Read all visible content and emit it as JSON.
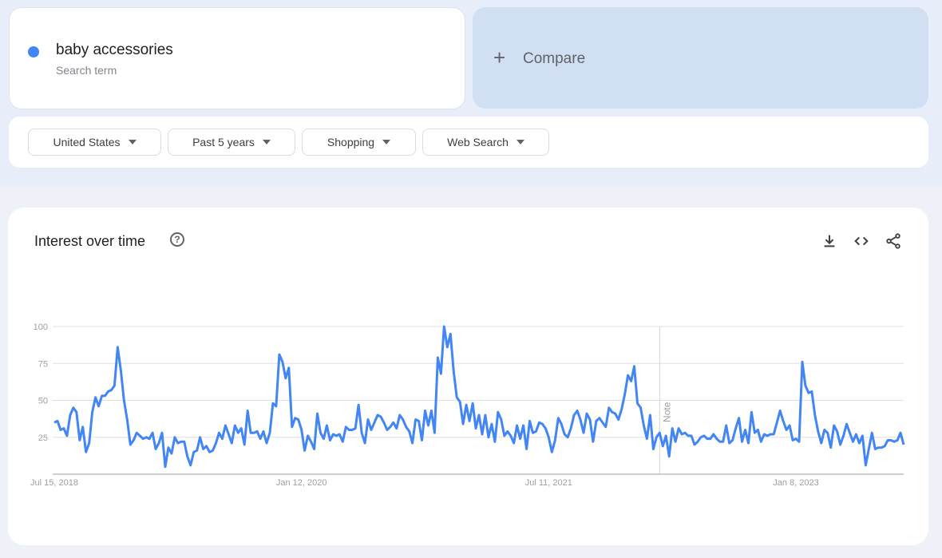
{
  "search_term": {
    "name": "baby accessories",
    "subtitle": "Search term",
    "color": "#4285f4"
  },
  "compare": {
    "icon": "plus-icon",
    "label": "Compare"
  },
  "filters": [
    {
      "label": "United States"
    },
    {
      "label": "Past 5 years"
    },
    {
      "label": "Shopping"
    },
    {
      "label": "Web Search"
    }
  ],
  "interest_panel": {
    "title": "Interest over time",
    "help_icon": "help-circle-icon",
    "actions": [
      "download-icon",
      "embed-code-icon",
      "share-icon"
    ]
  },
  "chart_data": {
    "type": "line",
    "title": "Interest over time",
    "xlabel": "",
    "ylabel": "",
    "ylim": [
      0,
      100
    ],
    "yticks": [
      25,
      50,
      75,
      100
    ],
    "xtick_labels": [
      {
        "label": "Jul 15, 2018",
        "index": 0
      },
      {
        "label": "Jan 12, 2020",
        "index": 78
      },
      {
        "label": "Jul 11, 2021",
        "index": 156
      },
      {
        "label": "Jan 8, 2023",
        "index": 234
      }
    ],
    "annotation": {
      "label": "Note",
      "index": 191
    },
    "grid": true,
    "legend": "none",
    "series": [
      {
        "name": "baby accessories",
        "color": "#4285f4",
        "values": [
          35,
          36,
          30,
          31,
          26,
          40,
          45,
          42,
          23,
          32,
          15,
          21,
          42,
          52,
          46,
          53,
          53,
          56,
          57,
          60,
          86,
          70,
          50,
          37,
          20,
          23,
          28,
          26,
          24,
          25,
          24,
          28,
          17,
          21,
          28,
          5,
          18,
          14,
          25,
          21,
          22,
          22,
          12,
          6,
          15,
          16,
          25,
          17,
          19,
          15,
          16,
          21,
          28,
          24,
          33,
          27,
          21,
          33,
          28,
          31,
          20,
          43,
          28,
          28,
          29,
          24,
          29,
          21,
          28,
          48,
          46,
          81,
          76,
          65,
          72,
          32,
          38,
          37,
          30,
          16,
          26,
          22,
          17,
          41,
          28,
          24,
          33,
          23,
          27,
          26,
          27,
          22,
          32,
          30,
          30,
          31,
          47,
          28,
          21,
          37,
          30,
          35,
          40,
          39,
          35,
          30,
          32,
          35,
          31,
          40,
          37,
          32,
          29,
          21,
          37,
          36,
          23,
          43,
          33,
          43,
          28,
          79,
          68,
          100,
          86,
          95,
          70,
          52,
          49,
          34,
          47,
          36,
          48,
          31,
          40,
          27,
          40,
          25,
          34,
          22,
          42,
          37,
          26,
          29,
          26,
          21,
          33,
          24,
          33,
          17,
          36,
          28,
          29,
          35,
          34,
          31,
          25,
          15,
          23,
          38,
          34,
          27,
          25,
          31,
          40,
          43,
          37,
          28,
          41,
          37,
          22,
          36,
          38,
          35,
          32,
          45,
          42,
          41,
          37,
          44,
          54,
          67,
          63,
          73,
          48,
          45,
          33,
          24,
          40,
          17,
          25,
          28,
          19,
          26,
          12,
          31,
          22,
          31,
          27,
          28,
          26,
          26,
          20,
          22,
          25,
          26,
          24,
          24,
          27,
          24,
          22,
          22,
          33,
          21,
          23,
          31,
          38,
          22,
          30,
          21,
          42,
          28,
          30,
          22,
          27,
          26,
          27,
          27,
          35,
          43,
          36,
          30,
          33,
          23,
          24,
          22,
          76,
          60,
          55,
          56,
          40,
          29,
          21,
          30,
          28,
          18,
          33,
          29,
          20,
          26,
          34,
          28,
          22,
          27,
          21,
          26,
          6,
          17,
          28,
          17,
          18,
          18,
          19,
          23,
          23,
          22,
          23,
          28,
          20
        ],
        "shown_peaks": {
          "max": 100
        }
      }
    ]
  }
}
